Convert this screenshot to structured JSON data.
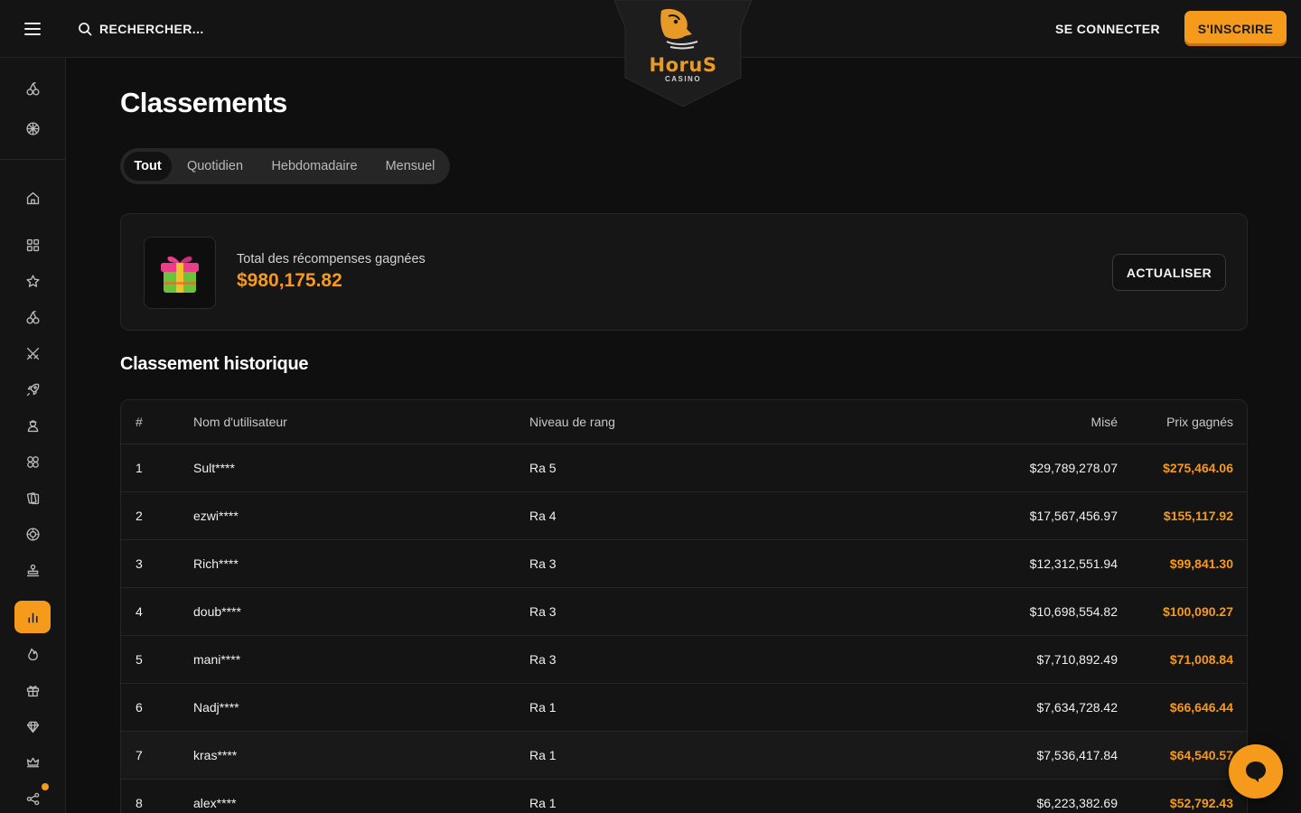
{
  "header": {
    "search_label": "RECHERCHER...",
    "logo_text": "HoruS",
    "logo_subtext": "CASINO",
    "login_label": "SE CONNECTER",
    "signup_label": "S'INSCRIRE"
  },
  "sidebar": {
    "items": [
      {
        "icon": "cherries-icon"
      },
      {
        "icon": "ball-icon"
      },
      {
        "icon": "home-icon"
      },
      {
        "icon": "grid-icon"
      },
      {
        "icon": "star-icon"
      },
      {
        "icon": "cherries-icon"
      },
      {
        "icon": "swords-icon"
      },
      {
        "icon": "rocket-icon"
      },
      {
        "icon": "dealer-icon"
      },
      {
        "icon": "clover-icon"
      },
      {
        "icon": "cards-icon"
      },
      {
        "icon": "chip-icon"
      },
      {
        "icon": "stamp-icon"
      },
      {
        "icon": "leaderboard-icon",
        "active": true
      },
      {
        "icon": "flame-icon"
      },
      {
        "icon": "gift-icon"
      },
      {
        "icon": "diamond-icon"
      },
      {
        "icon": "crown-icon"
      },
      {
        "icon": "affiliate-icon",
        "notification": true
      }
    ]
  },
  "page": {
    "title": "Classements",
    "tabs": [
      {
        "label": "Tout",
        "active": true
      },
      {
        "label": "Quotidien"
      },
      {
        "label": "Hebdomadaire"
      },
      {
        "label": "Mensuel"
      }
    ]
  },
  "rewards": {
    "label": "Total des récompenses gagnées",
    "value": "$980,175.82",
    "refresh_label": "ACTUALISER"
  },
  "leaderboard": {
    "title": "Classement historique",
    "columns": {
      "rank": "#",
      "user": "Nom d'utilisateur",
      "level": "Niveau de rang",
      "bet": "Misé",
      "prize": "Prix gagnés"
    },
    "rows": [
      {
        "rank": "1",
        "user": "Sult****",
        "level": "Ra 5",
        "bet": "$29,789,278.07",
        "prize": "$275,464.06"
      },
      {
        "rank": "2",
        "user": "ezwi****",
        "level": "Ra 4",
        "bet": "$17,567,456.97",
        "prize": "$155,117.92"
      },
      {
        "rank": "3",
        "user": "Rich****",
        "level": "Ra 3",
        "bet": "$12,312,551.94",
        "prize": "$99,841.30"
      },
      {
        "rank": "4",
        "user": "doub****",
        "level": "Ra 3",
        "bet": "$10,698,554.82",
        "prize": "$100,090.27"
      },
      {
        "rank": "5",
        "user": "mani****",
        "level": "Ra 3",
        "bet": "$7,710,892.49",
        "prize": "$71,008.84"
      },
      {
        "rank": "6",
        "user": "Nadj****",
        "level": "Ra 1",
        "bet": "$7,634,728.42",
        "prize": "$66,646.44"
      },
      {
        "rank": "7",
        "user": "kras****",
        "level": "Ra 1",
        "bet": "$7,536,417.84",
        "prize": "$64,540.57"
      },
      {
        "rank": "8",
        "user": "alex****",
        "level": "Ra 1",
        "bet": "$6,223,382.69",
        "prize": "$52,792.43"
      }
    ]
  },
  "colors": {
    "accent": "#f59a1a",
    "background": "#0f0f0f",
    "panel": "#141414"
  }
}
